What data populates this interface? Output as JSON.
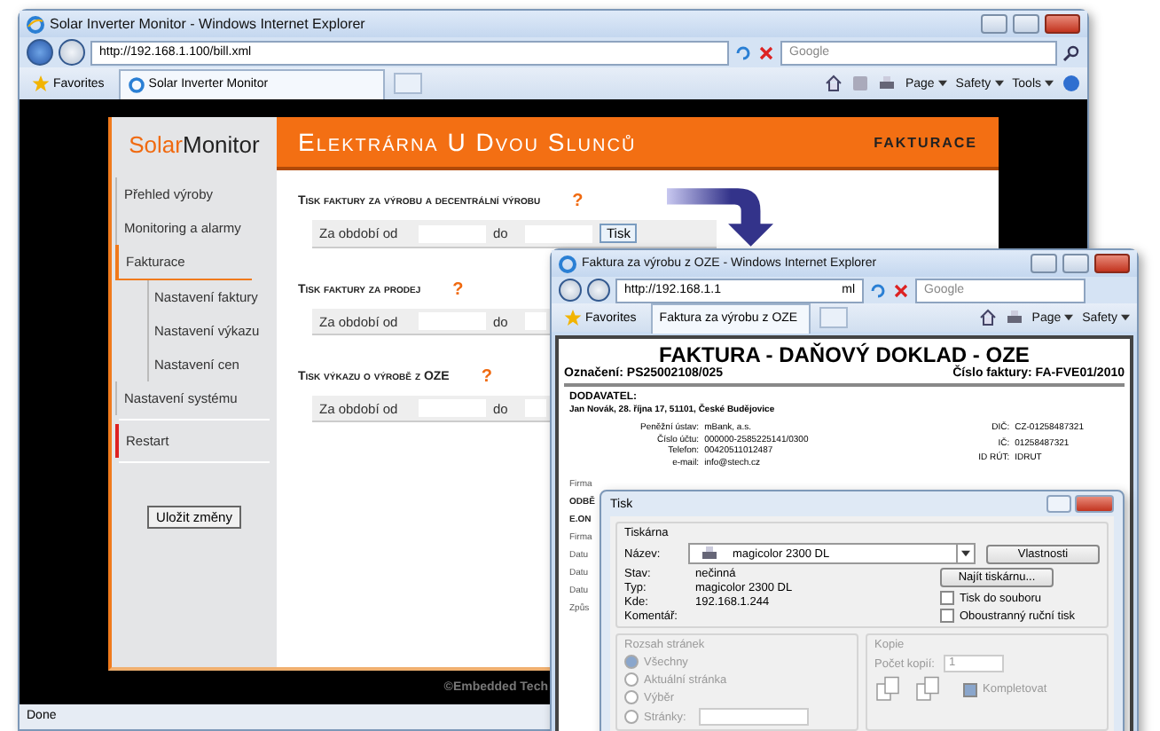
{
  "main_window": {
    "title": "Solar Inverter Monitor - Windows Internet Explorer",
    "address": "http://192.168.1.100/bill.xml",
    "search_placeholder": "Google",
    "favorites": "Favorites",
    "tab": "Solar Inverter Monitor",
    "menus": [
      "Page",
      "Safety",
      "Tools"
    ],
    "status": "Done"
  },
  "app": {
    "logo": [
      "Solar",
      "Monitor"
    ],
    "title": "Elektrárna U Dvou Slunců",
    "section_label": "FAKTURACE",
    "nav": [
      {
        "label": "Přehled výroby",
        "selected": false,
        "kind": "normal"
      },
      {
        "label": "Monitoring a alarmy",
        "selected": false,
        "kind": "normal"
      },
      {
        "label": "Fakturace",
        "selected": true,
        "kind": "normal",
        "children": [
          {
            "label": "Nastavení faktury",
            "selected": false
          },
          {
            "label": "Nastavení výkazu",
            "selected": false
          },
          {
            "label": "Nastavení cen",
            "selected": false
          }
        ]
      },
      {
        "label": "Nastavení systému",
        "selected": false,
        "kind": "normal"
      },
      {
        "label": "Restart",
        "selected": false,
        "kind": "danger"
      }
    ],
    "save_button": "Uložit změny",
    "sections": [
      {
        "title": "Tisk faktury za výrobu a decentrální výrobu",
        "help": "?",
        "from_label": "Za období od",
        "to_label": "do",
        "button": "Tisk"
      },
      {
        "title": "Tisk faktury za prodej",
        "help": "?",
        "from_label": "Za období od",
        "to_label": "do"
      },
      {
        "title": "Tisk výkazu o výrobě z OZE",
        "help": "?",
        "from_label": "Za období od",
        "to_label": "do"
      }
    ],
    "footer": "©Embedded Tech"
  },
  "invoice_window": {
    "title": "Faktura za výrobu z OZE - Windows Internet Explorer",
    "address": "http://192.168.1.1",
    "address_end": "ml",
    "search_placeholder": "Google",
    "favorites": "Favorites",
    "tab": "Faktura za výrobu z OZE",
    "menus": [
      "Page",
      "Safety"
    ],
    "heading": "FAKTURA - DAŇOVÝ DOKLAD - OZE",
    "designation": "Označení: PS25002108/025",
    "invoice_number": "Číslo faktury: FA-FVE01/2010",
    "supplier_label": "DODAVATEL:",
    "supplier": "Jan Novák, 28. října 17, 51101, České Budějovice",
    "details_left": [
      {
        "label": "Peněžní ústav:",
        "value": "mBank, a.s."
      },
      {
        "label": "Číslo účtu:",
        "value": "000000-2585225141/0300"
      },
      {
        "label": "Telefon:",
        "value": "00420511012487"
      },
      {
        "label": "e-mail:",
        "value": "info@stech.cz"
      }
    ],
    "details_right": [
      {
        "label": "DIČ:",
        "value": "CZ-01258487321"
      },
      {
        "label": "IČ:",
        "value": "01258487321"
      },
      {
        "label": "ID RÚT:",
        "value": "IDRUT"
      }
    ],
    "fragments": [
      "Firma",
      "ODBĚ",
      "E.ON",
      "Firma",
      "Datu",
      "Datu",
      "Datu",
      "Způs"
    ]
  },
  "print_dialog": {
    "title": "Tisk",
    "printer_group": "Tiskárna",
    "name_label": "Název:",
    "printer": "magicolor 2300 DL",
    "properties_button": "Vlastnosti",
    "find_button": "Najít tiskárnu...",
    "info": [
      {
        "label": "Stav:",
        "value": "nečinná"
      },
      {
        "label": "Typ:",
        "value": "magicolor 2300 DL"
      },
      {
        "label": "Kde:",
        "value": "192.168.1.244"
      },
      {
        "label": "Komentář:"
      }
    ],
    "options": [
      {
        "label": "Tisk do souboru",
        "checked": false
      },
      {
        "label": "Oboustranný ruční tisk",
        "checked": false
      }
    ],
    "range_group": "Rozsah stránek",
    "ranges": [
      {
        "label": "Všechny",
        "selected": true
      },
      {
        "label": "Aktuální stránka",
        "selected": false
      },
      {
        "label": "Výběr",
        "selected": false
      },
      {
        "label": "Stránky:",
        "selected": false
      }
    ],
    "copies_group": "Kopie",
    "copies_label": "Počet kopií:",
    "copies": "1",
    "collate": {
      "label": "Kompletovat",
      "checked": true
    }
  }
}
